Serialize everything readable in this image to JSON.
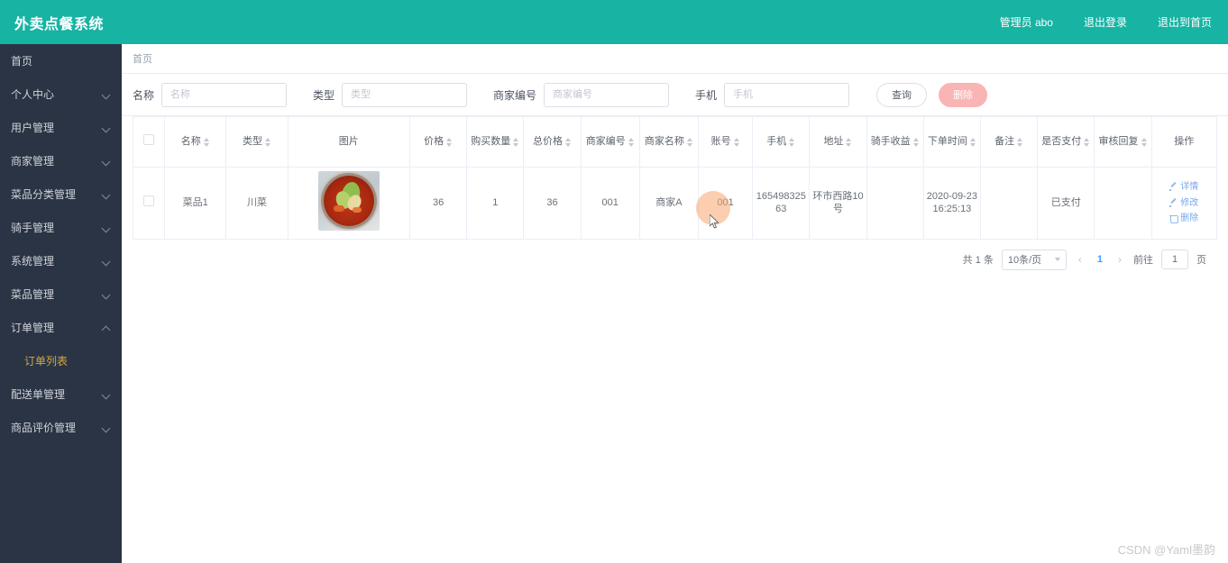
{
  "topbar": {
    "brand": "外卖点餐系统",
    "user": "管理员 abo",
    "logout": "退出登录",
    "exit_home": "退出到首页"
  },
  "sidebar": {
    "items": [
      {
        "label": "首页",
        "expandable": false,
        "expanded": false
      },
      {
        "label": "个人中心",
        "expandable": true,
        "expanded": false
      },
      {
        "label": "用户管理",
        "expandable": true,
        "expanded": false
      },
      {
        "label": "商家管理",
        "expandable": true,
        "expanded": false
      },
      {
        "label": "菜品分类管理",
        "expandable": true,
        "expanded": false
      },
      {
        "label": "骑手管理",
        "expandable": true,
        "expanded": false
      },
      {
        "label": "系统管理",
        "expandable": true,
        "expanded": false
      },
      {
        "label": "菜品管理",
        "expandable": true,
        "expanded": false
      },
      {
        "label": "订单管理",
        "expandable": true,
        "expanded": true
      }
    ],
    "active_submenu": "订单列表",
    "items_after": [
      {
        "label": "配送单管理",
        "expandable": true,
        "expanded": false
      },
      {
        "label": "商品评价管理",
        "expandable": true,
        "expanded": false
      }
    ]
  },
  "breadcrumb": "首页",
  "filter": {
    "name_label": "名称",
    "name_placeholder": "名称",
    "name_value": "",
    "type_label": "类型",
    "type_placeholder": "类型",
    "type_value": "",
    "merchant_label": "商家编号",
    "merchant_placeholder": "商家编号",
    "merchant_value": "",
    "phone_label": "手机",
    "phone_placeholder": "手机",
    "phone_value": "",
    "query_button": "查询",
    "delete_button": "删除"
  },
  "table": {
    "headers": [
      {
        "label": "名称",
        "sortable": true
      },
      {
        "label": "类型",
        "sortable": true
      },
      {
        "label": "图片",
        "sortable": false
      },
      {
        "label": "价格",
        "sortable": true
      },
      {
        "label": "购买数量",
        "sortable": true
      },
      {
        "label": "总价格",
        "sortable": true
      },
      {
        "label": "商家编号",
        "sortable": true
      },
      {
        "label": "商家名称",
        "sortable": true
      },
      {
        "label": "账号",
        "sortable": true
      },
      {
        "label": "手机",
        "sortable": true
      },
      {
        "label": "地址",
        "sortable": true
      },
      {
        "label": "骑手收益",
        "sortable": true
      },
      {
        "label": "下单时间",
        "sortable": true
      },
      {
        "label": "备注",
        "sortable": true
      },
      {
        "label": "是否支付",
        "sortable": true
      },
      {
        "label": "审核回复",
        "sortable": true
      },
      {
        "label": "操作",
        "sortable": false
      }
    ],
    "rows": [
      {
        "name": "菜品1",
        "type": "川菜",
        "image": "food-thumbnail",
        "price": "36",
        "quantity": "1",
        "total": "36",
        "merchant_id": "001",
        "merchant_name": "商家A",
        "account": "001",
        "phone": "16549832563",
        "address": "环市西路10号",
        "rider_income": "",
        "order_time": "2020-09-23 16:25:13",
        "remark": "",
        "paid": "已支付",
        "review_reply": "",
        "actions": [
          "详情",
          "修改",
          "删除"
        ]
      }
    ]
  },
  "pagination": {
    "total_text": "共 1 条",
    "page_size": "10条/页",
    "prev": "‹",
    "current_page": "1",
    "next": "›",
    "jump_label": "前往",
    "jump_value": "1",
    "jump_unit": "页"
  },
  "watermark": "CSDN @Yaml墨韵",
  "colors": {
    "brand_teal": "#17b3a3",
    "sidebar_dark": "#2b3444",
    "active_gold": "#d4a941",
    "delete_pink": "#f9b4b4",
    "link_blue": "#77a8f0",
    "page_blue": "#409eff"
  }
}
